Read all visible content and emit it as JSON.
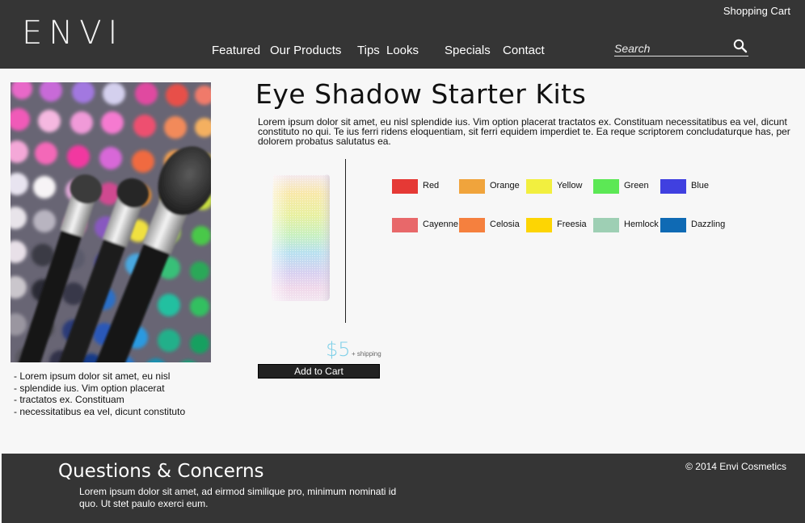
{
  "header": {
    "logo": "ENVI",
    "cart_label": "Shopping Cart",
    "nav": [
      "Featured",
      "Our Products",
      "Tips",
      "Looks",
      "Specials",
      "Contact"
    ],
    "search_placeholder": "Search"
  },
  "hero": {
    "bullets": [
      "- Lorem ipsum dolor sit amet, eu nisl",
      "- splendide ius. Vim option placerat",
      "- tractatos ex. Constituam",
      "- necessitatibus ea vel, dicunt constituto"
    ]
  },
  "product": {
    "title": "Eye Shadow Starter Kits",
    "description": "Lorem ipsum dolor sit amet, eu nisl splendide ius. Vim option placerat tractatos ex. Constituam necessitatibus ea vel, dicunt constituto no qui. Te ius ferri ridens eloquentiam, sit ferri equidem imperdiet te. Ea reque scriptorem concludaturque has, per dolorem probatus salutatus ea.",
    "price": "$5",
    "shipping_note": "+ shipping",
    "add_to_cart": "Add to Cart",
    "swatches": [
      {
        "name": "Red",
        "color": "#e53935"
      },
      {
        "name": "Orange",
        "color": "#f0a43c"
      },
      {
        "name": "Yellow",
        "color": "#f2ef3f"
      },
      {
        "name": "Green",
        "color": "#5ce855"
      },
      {
        "name": "Blue",
        "color": "#4040e0"
      },
      {
        "name": "Cayenne",
        "color": "#e8686a"
      },
      {
        "name": "Celosia",
        "color": "#f5803e"
      },
      {
        "name": "Freesia",
        "color": "#fdd503"
      },
      {
        "name": "Hemlock",
        "color": "#9ecfb4"
      },
      {
        "name": "Dazzling",
        "color": "#0f6ab4"
      }
    ]
  },
  "footer": {
    "title": "Questions & Concerns",
    "text": "Lorem ipsum dolor sit amet, ad eirmod similique pro, minimum nominati id quo. Ut stet paulo exerci eum.",
    "copyright": "© 2014 Envi Cosmetics"
  }
}
